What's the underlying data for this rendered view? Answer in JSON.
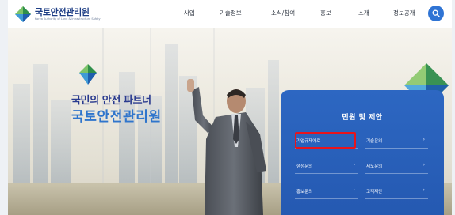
{
  "header": {
    "logo_name": "국토안전관리원",
    "logo_sub": "Korea Authority of Land & Infrastructure Safety",
    "nav": [
      {
        "label": "사업"
      },
      {
        "label": "기술정보"
      },
      {
        "label": "소식/참여"
      },
      {
        "label": "홍보"
      },
      {
        "label": "소개"
      },
      {
        "label": "정보공개"
      }
    ],
    "search_icon": "search-icon"
  },
  "hero": {
    "line1": "국민의 안전 파트너",
    "line2": "국토안전관리원"
  },
  "panel": {
    "title": "민원 및 제안",
    "items": [
      {
        "label": "기업규제애로"
      },
      {
        "label": "기술문의"
      },
      {
        "label": "행정문의"
      },
      {
        "label": "제도문의"
      },
      {
        "label": "홍보문의"
      },
      {
        "label": "고객제안"
      }
    ],
    "arrow": "›"
  },
  "colors": {
    "brand_navy": "#2a3b8f",
    "brand_blue": "#2f75cc",
    "panel_blue": "#2d67c2",
    "highlight_red": "#e8141c"
  }
}
